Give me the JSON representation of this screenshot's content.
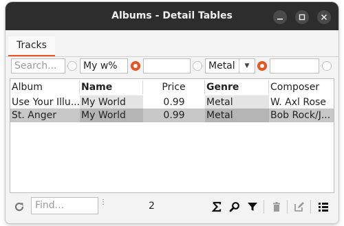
{
  "window": {
    "title": "Albums - Detail Tables",
    "controls": {
      "minimize": "–",
      "maximize": "□",
      "close": "×"
    }
  },
  "tabs": [
    {
      "label": "Tracks",
      "active": true
    }
  ],
  "filters": {
    "search_placeholder": "Search...",
    "name_filter": "My w%",
    "genre_select": "Metal",
    "radios": [
      false,
      true,
      false,
      true,
      false
    ]
  },
  "table": {
    "columns": [
      {
        "label": "Album",
        "bold": false
      },
      {
        "label": "Name",
        "bold": true
      },
      {
        "label": "Price",
        "bold": false
      },
      {
        "label": "Genre",
        "bold": true
      },
      {
        "label": "Composer",
        "bold": false
      }
    ],
    "rows": [
      {
        "album": "Use Your Illu...",
        "name": "My World",
        "price": "0.99",
        "genre": "Metal",
        "composer": "W. Axl Rose",
        "selected": false
      },
      {
        "album": "St. Anger",
        "name": "My World",
        "price": "0.99",
        "genre": "Metal",
        "composer": "Bob Rock/J...",
        "selected": true
      }
    ]
  },
  "status": {
    "find_placeholder": "Find...",
    "record_count": "2"
  },
  "colors": {
    "accent": "#e95420",
    "titlebar": "#2d2d2d",
    "selected_row": "#c7c7c7"
  },
  "icons": [
    "refresh-icon",
    "sum-icon",
    "search-icon",
    "filter-icon",
    "trash-icon",
    "edit-icon",
    "list-icon"
  ]
}
